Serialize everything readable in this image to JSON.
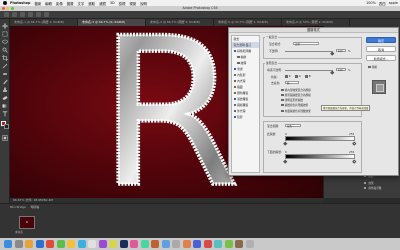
{
  "menubar": {
    "app_name": "Photoshop",
    "menus": [
      "檔案",
      "編輯",
      "影像",
      "圖層",
      "文字",
      "選取",
      "濾鏡",
      "3D",
      "檢視",
      "視窗",
      "說明"
    ],
    "right_items": [
      "100%",
      "週四",
      "apple"
    ]
  },
  "window": {
    "title": "Adobe Photoshop CS6"
  },
  "tabs": [
    {
      "label": "未命名-1 @ 66.7% (圖層 1, RGB/8)",
      "active": false
    },
    {
      "label": "未命名-3 @ 66.7% (R, RGB/8)",
      "active": true
    },
    {
      "label": "未命名-4 @ 66.7% (圖層 2, RGB/8)",
      "active": false
    },
    {
      "label": "未命名-5 @ 44.3% (圖層 1, RGB/8)",
      "active": false
    },
    {
      "label": "未命名-6 @ 50% (圖層 2, RGB/8)",
      "active": false
    }
  ],
  "canvas": {
    "letter": "R"
  },
  "status": {
    "text": "66.67%    文件: 18.9M/60.2M"
  },
  "bottom": {
    "tabs": [
      "Mini Bridge",
      "時間軸"
    ],
    "thumb_caption": "未命名"
  },
  "dialog": {
    "title": "圖層樣式",
    "left_items": [
      {
        "label": "樣式",
        "checked": false,
        "selected": false
      },
      {
        "label": "混合選項:自訂",
        "checked": false,
        "selected": true
      },
      {
        "label": "斜角和浮雕",
        "checked": true,
        "selected": false
      },
      {
        "label": "輪廓",
        "checked": false,
        "selected": false
      },
      {
        "label": "紋理",
        "checked": false,
        "selected": false
      },
      {
        "label": "筆畫",
        "checked": true,
        "selected": false
      },
      {
        "label": "內陰影",
        "checked": false,
        "selected": false
      },
      {
        "label": "內光暈",
        "checked": false,
        "selected": false
      },
      {
        "label": "緞面",
        "checked": false,
        "selected": false
      },
      {
        "label": "顏色覆蓋",
        "checked": false,
        "selected": false
      },
      {
        "label": "漸層覆蓋",
        "checked": true,
        "selected": false
      },
      {
        "label": "圖樣覆蓋",
        "checked": false,
        "selected": false
      },
      {
        "label": "外光暈",
        "checked": false,
        "selected": false
      },
      {
        "label": "陰影",
        "checked": true,
        "selected": false
      }
    ],
    "general": {
      "heading": "一般混合",
      "blend_label": "混合模式:",
      "blend_value": "正常",
      "opacity_label": "不透明:",
      "opacity_value": "100",
      "percent": "%"
    },
    "advanced": {
      "heading": "進階混合",
      "fill_label": "填滿不透明:",
      "fill_value": "100",
      "percent": "%",
      "channels_label": "色版:",
      "channels": [
        "R",
        "G",
        "B"
      ],
      "knockout_label": "去底色:",
      "knockout_value": "無",
      "options": [
        {
          "label": "將內部效果混合為群組",
          "checked": false
        },
        {
          "label": "將剪裁圖層混合為群組",
          "checked": true
        },
        {
          "label": "透明度形狀圖層",
          "checked": true
        },
        {
          "label": "圖層遮色片隱藏效果",
          "checked": false
        },
        {
          "label": "向量圖遮色片隱藏效果",
          "checked": false
        }
      ],
      "tooltip": "將剪裁圖層混合為群組，再混合到基底圖層"
    },
    "blendif": {
      "heading": "混合範圍:",
      "value": "灰色",
      "this_layer_label": "此圖層:",
      "this_layer_min": "0",
      "this_layer_max": "255",
      "under_layer_label": "下面的圖層:",
      "under_layer_min": "0",
      "under_layer_max": "255"
    },
    "buttons": {
      "ok": "確定",
      "cancel": "取消",
      "new_style": "新增樣式...",
      "preview": "預視"
    }
  },
  "layers_panel": [
    "效果",
    "斜角和浮雕",
    "筆畫",
    "漸層覆蓋",
    "陰影",
    "效果",
    "斜角和浮雕"
  ],
  "colors": {
    "foreground": "#cc1111",
    "background": "#222222",
    "accent": "#3d7ad6"
  }
}
